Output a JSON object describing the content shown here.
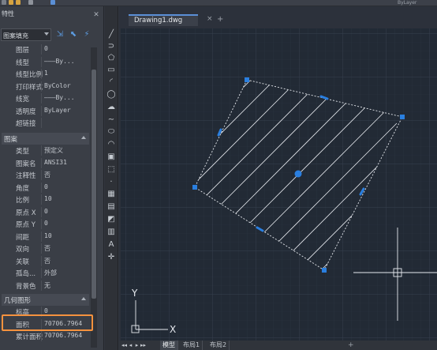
{
  "toolbar": {
    "layer_field": "ByLayer",
    "icons": [
      "menu-icon",
      "folder-icon",
      "save-icon",
      "undo-icon",
      "layer-icon"
    ]
  },
  "palette": {
    "title": "特性",
    "close_label": "✕",
    "selector": {
      "value": "图案填充"
    },
    "buttons": [
      "toggle-pickadd-icon",
      "select-objects-icon",
      "quick-select-icon"
    ],
    "general_rows": [
      {
        "key": "图层",
        "value": "0"
      },
      {
        "key": "线型",
        "value": "———By..."
      },
      {
        "key": "线型比例",
        "value": "1"
      },
      {
        "key": "打印样式",
        "value": "ByColor"
      },
      {
        "key": "线宽",
        "value": "———By..."
      },
      {
        "key": "透明度",
        "value": "ByLayer"
      },
      {
        "key": "超链接",
        "value": ""
      }
    ],
    "pattern_section": "图案",
    "pattern_rows": [
      {
        "key": "类型",
        "value": "预定义"
      },
      {
        "key": "图案名",
        "value": "ANSI31"
      },
      {
        "key": "注释性",
        "value": "否"
      },
      {
        "key": "角度",
        "value": "0"
      },
      {
        "key": "比例",
        "value": "10"
      },
      {
        "key": "原点 X",
        "value": "0"
      },
      {
        "key": "原点 Y",
        "value": "0"
      },
      {
        "key": "间距",
        "value": "10"
      },
      {
        "key": "双向",
        "value": "否"
      },
      {
        "key": "关联",
        "value": "否"
      },
      {
        "key": "孤岛...",
        "value": "外部"
      },
      {
        "key": "背景色",
        "value": "无"
      }
    ],
    "geometry_section": "几何图形",
    "geometry_rows": [
      {
        "key": "标高",
        "value": "0"
      },
      {
        "key": "面积",
        "value": "70706.7964"
      },
      {
        "key": "累计面积",
        "value": "70706.7964"
      }
    ]
  },
  "tools": [
    "line-icon",
    "polyline-icon",
    "polygon-icon",
    "rectangle-icon",
    "arc-icon",
    "circle-icon",
    "revcloud-icon",
    "spline-icon",
    "ellipse-icon",
    "ellipse-arc-icon",
    "insert-block-icon",
    "make-block-icon",
    "point-icon",
    "hatch-icon",
    "gradient-icon",
    "region-icon",
    "table-icon",
    "mtext-icon",
    "add-selected-icon"
  ],
  "tool_glyphs": [
    "╱",
    "⊃",
    "⬠",
    "▭",
    "◜",
    "◯",
    "☁",
    "∼",
    "⬭",
    "◠",
    "▣",
    "⬚",
    "·",
    "▦",
    "▤",
    "◩",
    "▥",
    "A",
    "✛"
  ],
  "document": {
    "tab_label": "Drawing1.dwg",
    "close_label": "×",
    "add_label": "+"
  },
  "ucs": {
    "x_label": "X",
    "y_label": "Y"
  },
  "layout_tabs": {
    "nav": [
      "◂◂",
      "◂",
      "▸",
      "▸▸"
    ],
    "tabs": [
      "模型",
      "布局1",
      "布局2"
    ],
    "active": 0,
    "add_label": "+"
  },
  "colors": {
    "accent": "#5b8fd6",
    "grip": "#2a7fe0",
    "highlight": "#f5923e",
    "canvas": "#222a35"
  }
}
